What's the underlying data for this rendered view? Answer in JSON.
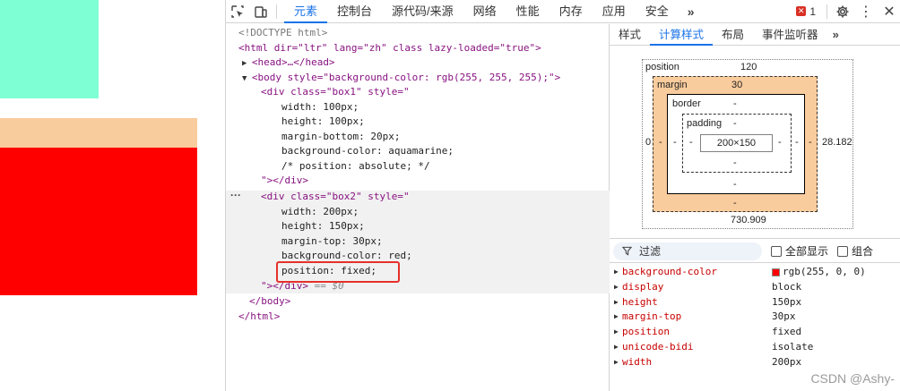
{
  "devtools": {
    "main_tabs": [
      "元素",
      "控制台",
      "源代码/来源",
      "网络",
      "性能",
      "内存",
      "应用",
      "安全"
    ],
    "active_tab": "元素",
    "more_tabs": "»",
    "error_count": "1"
  },
  "elements": {
    "lines": [
      {
        "t": "<!DOCTYPE html>"
      },
      {
        "t": "<html dir=\"ltr\" lang=\"zh\" class lazy-loaded=\"true\">"
      },
      {
        "t": "<head>…</head>"
      },
      {
        "t": "<body style=\"background-color: rgb(255, 255, 255);\">"
      },
      {
        "t": "<div class=\"box1\" style=\""
      },
      {
        "t": "width: 100px;"
      },
      {
        "t": "height: 100px;"
      },
      {
        "t": "margin-bottom: 20px;"
      },
      {
        "t": "background-color: aquamarine;"
      },
      {
        "t": "/* position: absolute; */"
      },
      {
        "t": "\"></div>"
      },
      {
        "t": "<div class=\"box2\" style=\""
      },
      {
        "t": "width: 200px;"
      },
      {
        "t": "height: 150px;"
      },
      {
        "t": "margin-top: 30px;"
      },
      {
        "t": "background-color: red;"
      },
      {
        "t": "position: fixed;"
      },
      {
        "t": "\"></div>"
      },
      {
        "t": "</body>"
      },
      {
        "t": "</html>"
      }
    ],
    "selected_marker": "== $0"
  },
  "sidebar": {
    "tabs": [
      "样式",
      "计算样式",
      "布局",
      "事件监听器"
    ],
    "active_tab": "计算样式",
    "more": "»",
    "box_model": {
      "position_label": "position",
      "position_top": "120",
      "position_left": "0",
      "position_right": "28.182",
      "position_bottom": "730.909",
      "margin_label": "margin",
      "margin_top": "30",
      "margin_left": "-",
      "margin_right": "-",
      "margin_bottom": "-",
      "border_label": "border",
      "border_top": "-",
      "border_left": "-",
      "border_right": "-",
      "border_bottom": "-",
      "padding_label": "padding",
      "padding_top": "-",
      "padding_left": "-",
      "padding_right": "-",
      "padding_bottom": "-",
      "content": "200×150"
    },
    "filter": {
      "placeholder": "过滤",
      "show_all": "全部显示",
      "group": "组合"
    },
    "properties": [
      {
        "name": "background-color",
        "value": "rgb(255, 0, 0)",
        "swatch": "#ff0000"
      },
      {
        "name": "display",
        "value": "block"
      },
      {
        "name": "height",
        "value": "150px"
      },
      {
        "name": "margin-top",
        "value": "30px"
      },
      {
        "name": "position",
        "value": "fixed"
      },
      {
        "name": "unicode-bidi",
        "value": "isolate"
      },
      {
        "name": "width",
        "value": "200px"
      }
    ]
  },
  "preview": {
    "box1_color": "#7fffd4",
    "box2_color": "#ff0000",
    "margin_color": "#f9cc9d"
  },
  "watermark": "CSDN @Ashy-"
}
